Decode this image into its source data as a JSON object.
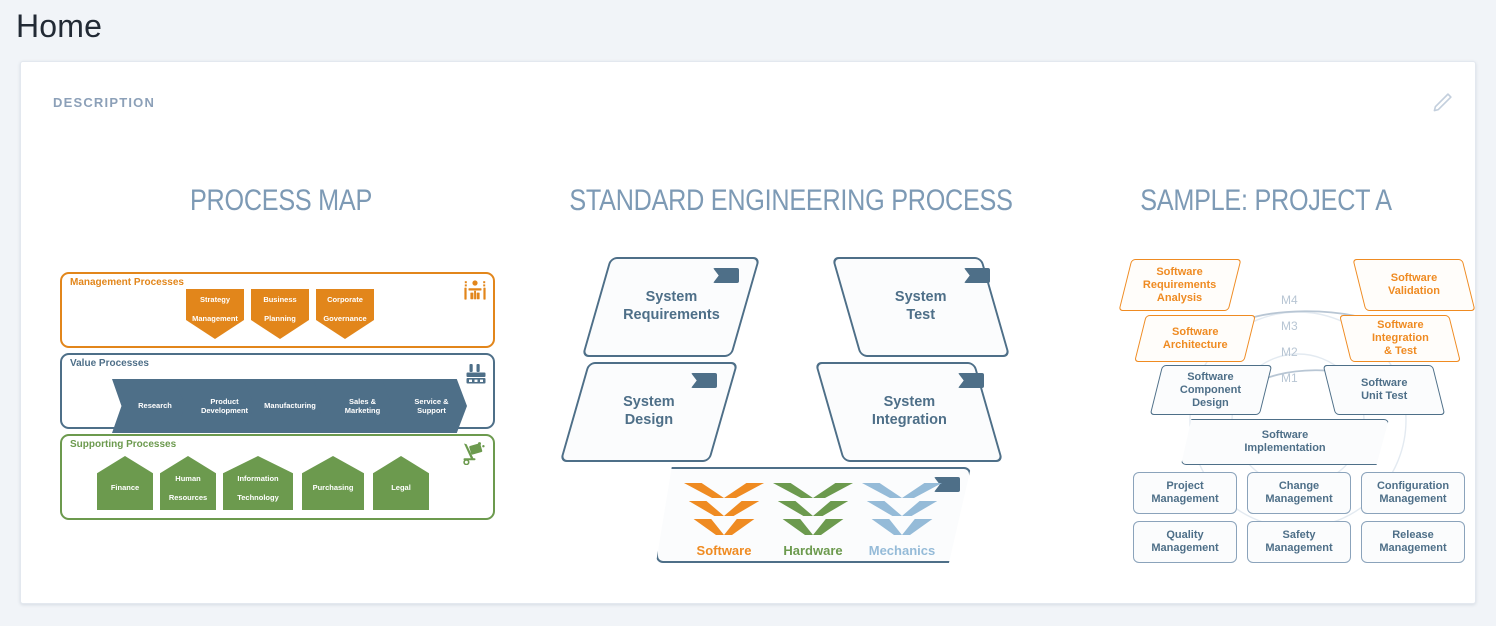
{
  "page": {
    "title": "Home"
  },
  "card": {
    "section_label": "DESCRIPTION",
    "edit_icon": "pencil-icon"
  },
  "columns": {
    "process_map_title": "PROCESS MAP",
    "engineering_title": "STANDARD ENGINEERING PROCESS",
    "project_title": "SAMPLE: PROJECT A"
  },
  "process_map": {
    "bands": [
      {
        "label": "Management Processes",
        "color": "#e2861b",
        "icon": "presentation-people-icon",
        "items": [
          {
            "line1": "Strategy",
            "line2": "Management"
          },
          {
            "line1": "Business",
            "line2": "Planning"
          },
          {
            "line1": "Corporate",
            "line2": "Governance"
          }
        ]
      },
      {
        "label": "Value Processes",
        "color": "#4e6f88",
        "icon": "factory-icon",
        "items": [
          {
            "line1": "Research",
            "line2": ""
          },
          {
            "line1": "Product",
            "line2": "Development"
          },
          {
            "line1": "Manufacturing",
            "line2": ""
          },
          {
            "line1": "Sales &",
            "line2": "Marketing"
          },
          {
            "line1": "Service &",
            "line2": "Support"
          }
        ]
      },
      {
        "label": "Supporting Processes",
        "color": "#6c9a4e",
        "icon": "hand-truck-icon",
        "items": [
          {
            "line1": "Finance",
            "line2": ""
          },
          {
            "line1": "Human",
            "line2": "Resources"
          },
          {
            "line1": "Information",
            "line2": "Technology"
          },
          {
            "line1": "Purchasing",
            "line2": ""
          },
          {
            "line1": "Legal",
            "line2": ""
          }
        ]
      }
    ]
  },
  "engineering_process": {
    "stages": [
      {
        "line1": "System",
        "line2": "Requirements"
      },
      {
        "line1": "System",
        "line2": "Test"
      },
      {
        "line1": "System",
        "line2": "Design"
      },
      {
        "line1": "System",
        "line2": "Integration"
      }
    ],
    "disciplines": [
      {
        "label": "Software",
        "color": "#ef8b22"
      },
      {
        "label": "Hardware",
        "color": "#6c9a4e"
      },
      {
        "label": "Mechanics",
        "color": "#95bbd8"
      }
    ]
  },
  "project_a": {
    "left_stages": [
      {
        "line1": "Software",
        "line2": "Requirements",
        "line3": "Analysis",
        "highlight": true
      },
      {
        "line1": "Software",
        "line2": "Architecture",
        "line3": "",
        "highlight": true
      },
      {
        "line1": "Software",
        "line2": "Component",
        "line3": "Design",
        "highlight": false
      }
    ],
    "right_stages": [
      {
        "line1": "Software",
        "line2": "Validation",
        "line3": "",
        "highlight": true
      },
      {
        "line1": "Software",
        "line2": "Integration",
        "line3": "& Test",
        "highlight": true
      },
      {
        "line1": "Software",
        "line2": "Unit Test",
        "line3": "",
        "highlight": false
      }
    ],
    "bottom_stage": {
      "line1": "Software",
      "line2": "Implementation"
    },
    "milestones": [
      "M4",
      "M3",
      "M2",
      "M1"
    ],
    "management_boxes": [
      {
        "line1": "Project",
        "line2": "Management"
      },
      {
        "line1": "Change",
        "line2": "Management"
      },
      {
        "line1": "Configuration",
        "line2": "Management"
      },
      {
        "line1": "Quality",
        "line2": "Management"
      },
      {
        "line1": "Safety",
        "line2": "Management"
      },
      {
        "line1": "Release",
        "line2": "Management"
      }
    ]
  },
  "colors": {
    "orange": "#e2861b",
    "orange_bright": "#ef8b22",
    "blue": "#4e6f88",
    "green": "#6c9a4e",
    "light_blue": "#95bbd8",
    "title_blue": "#7d9ab5",
    "page_bg": "#f1f4f8"
  }
}
